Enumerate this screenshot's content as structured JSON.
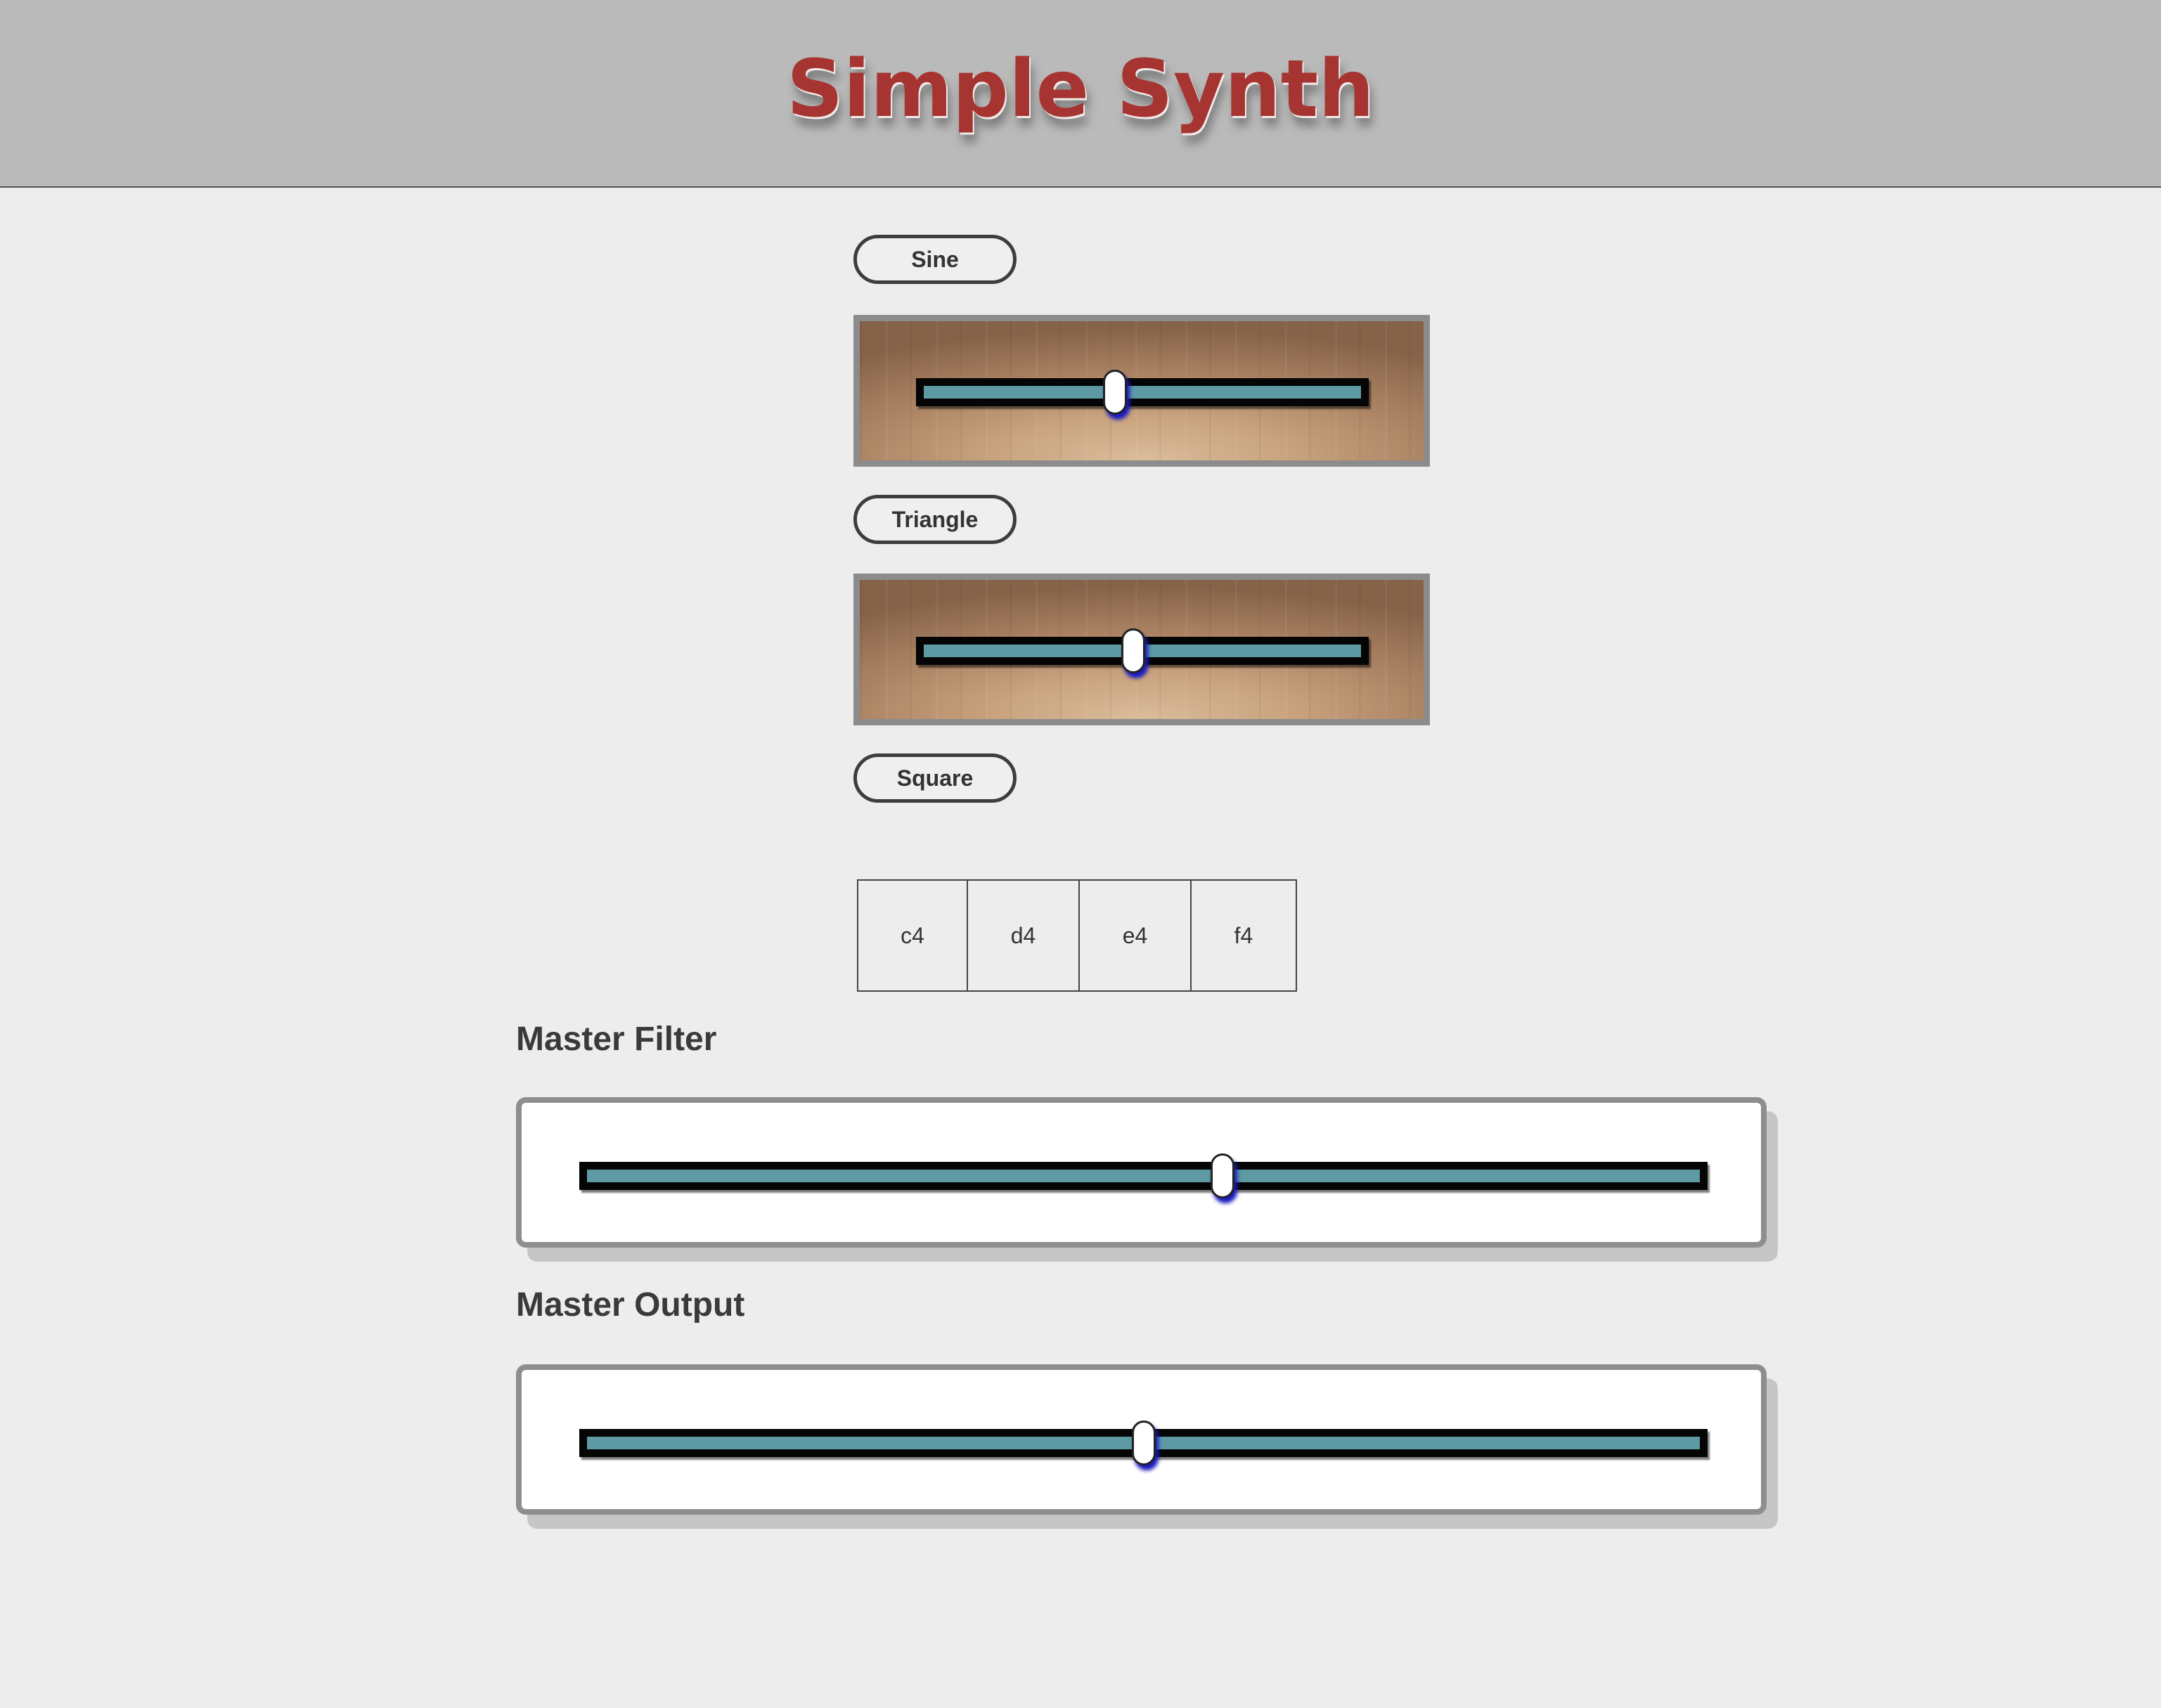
{
  "header": {
    "title": "Simple Synth"
  },
  "oscillators": [
    {
      "label": "Sine",
      "slider_value": 0.44
    },
    {
      "label": "Triangle",
      "slider_value": 0.48
    },
    {
      "label": "Square"
    }
  ],
  "keyboard": {
    "keys": [
      "c4",
      "d4",
      "e4",
      "f4"
    ]
  },
  "master_filter": {
    "label": "Master Filter",
    "slider_value": 0.57
  },
  "master_output": {
    "label": "Master Output",
    "slider_value": 0.5
  },
  "colors": {
    "title": "#a63532",
    "header_background": "#bababa",
    "page_background": "#ededed",
    "slider_track": "#5d9aa4",
    "slider_thumb_glow": "#1a1ac0"
  }
}
